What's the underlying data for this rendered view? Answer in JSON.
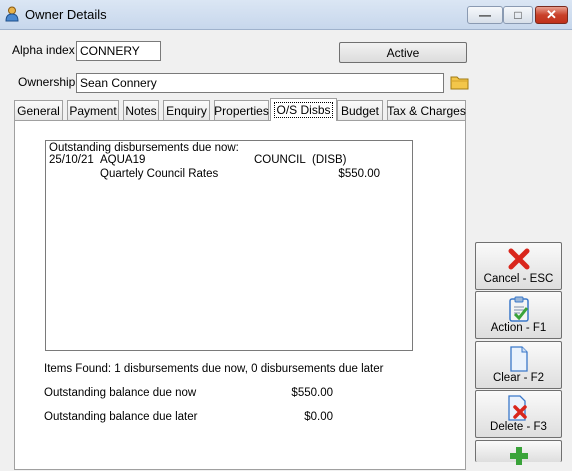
{
  "window": {
    "title": "Owner Details",
    "controls": {
      "minimize": "—",
      "maximize": "□",
      "close": "✕"
    }
  },
  "header": {
    "alpha_index_label": "Alpha index",
    "alpha_index_value": "CONNERY",
    "status_button": "Active",
    "ownership_label": "Ownership",
    "ownership_value": "Sean Connery"
  },
  "tabs": [
    {
      "label": "General"
    },
    {
      "label": "Payment"
    },
    {
      "label": "Notes"
    },
    {
      "label": "Enquiry"
    },
    {
      "label": "Properties"
    },
    {
      "label": "O/S Disbs",
      "selected": true
    },
    {
      "label": "Budget"
    },
    {
      "label": "Tax & Charges"
    }
  ],
  "disbursements": {
    "heading": "Outstanding disbursements due now:",
    "rows": [
      {
        "date": "25/10/21",
        "code": "AQUA19",
        "payee": "COUNCIL",
        "type": "(DISB)",
        "description": "Quartely Council Rates",
        "amount": "$550.00"
      }
    ],
    "items_found": "Items Found: 1 disbursements due now, 0 disbursements due later",
    "balance_now_label": "Outstanding balance due now",
    "balance_now_value": "$550.00",
    "balance_later_label": "Outstanding balance due later",
    "balance_later_value": "$0.00"
  },
  "actions": [
    {
      "label": "Cancel - ESC",
      "icon": "red-x-icon"
    },
    {
      "label": "Action - F1",
      "icon": "clipboard-check-icon"
    },
    {
      "label": "Clear - F2",
      "icon": "blank-page-icon"
    },
    {
      "label": "Delete - F3",
      "icon": "delete-page-icon"
    },
    {
      "label": "",
      "icon": "green-plus-icon"
    }
  ],
  "colors": {
    "accent_red": "#d9261c",
    "accent_green": "#3aa33a",
    "accent_blue": "#3b78c9",
    "close_button": "#c9412a"
  }
}
